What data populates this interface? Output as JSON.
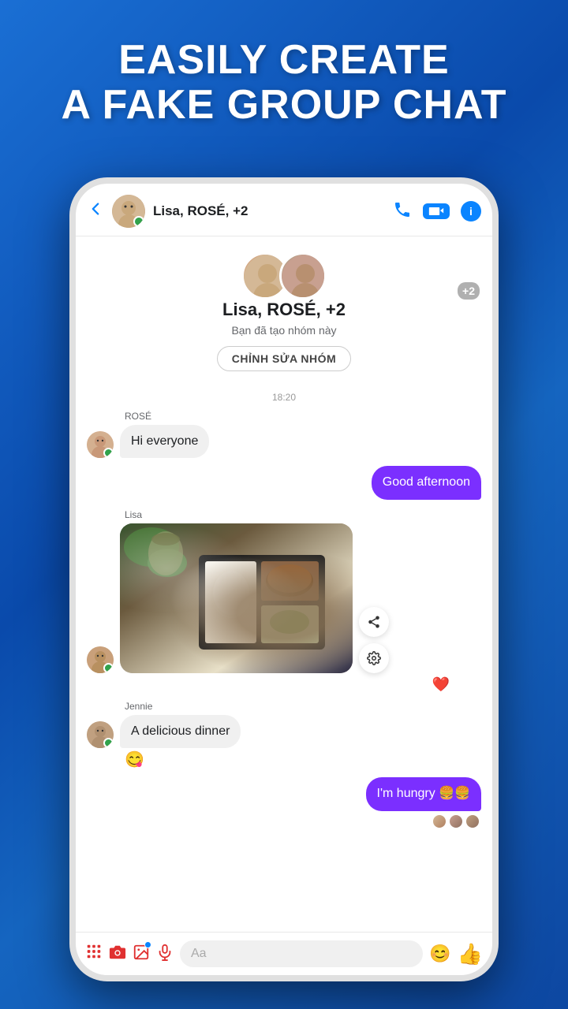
{
  "page": {
    "title_line1": "EASILY CREATE",
    "title_line2": "A FAKE GROUP CHAT"
  },
  "header": {
    "group_name": "Lisa, ROSÉ, +2",
    "back_label": "‹",
    "call_icon": "📞",
    "video_icon": "📹",
    "info_icon": "i"
  },
  "group_info": {
    "name": "Lisa, ROSÉ, +2",
    "sub_text": "Bạn đã tạo nhóm này",
    "edit_button": "CHỈNH SỬA NHÓM",
    "plus_count": "+2"
  },
  "chat": {
    "timestamp": "18:20",
    "messages": [
      {
        "id": "msg1",
        "sender": "ROSÉ",
        "text": "Hi everyone",
        "type": "received"
      },
      {
        "id": "msg2",
        "sender": "me",
        "text": "Good afternoon",
        "type": "sent"
      },
      {
        "id": "msg3",
        "sender": "Lisa",
        "text": "",
        "type": "image"
      },
      {
        "id": "msg4",
        "sender": "Jennie",
        "text": "A delicious dinner",
        "type": "received"
      },
      {
        "id": "msg5",
        "sender": "me",
        "text": "I'm hungry 🍔🍔",
        "type": "sent"
      }
    ],
    "heart_reaction": "❤️",
    "emoji_reaction": "😋"
  },
  "toolbar": {
    "input_placeholder": "Aa",
    "emoji_icon": "😊",
    "like_icon": "👍"
  }
}
